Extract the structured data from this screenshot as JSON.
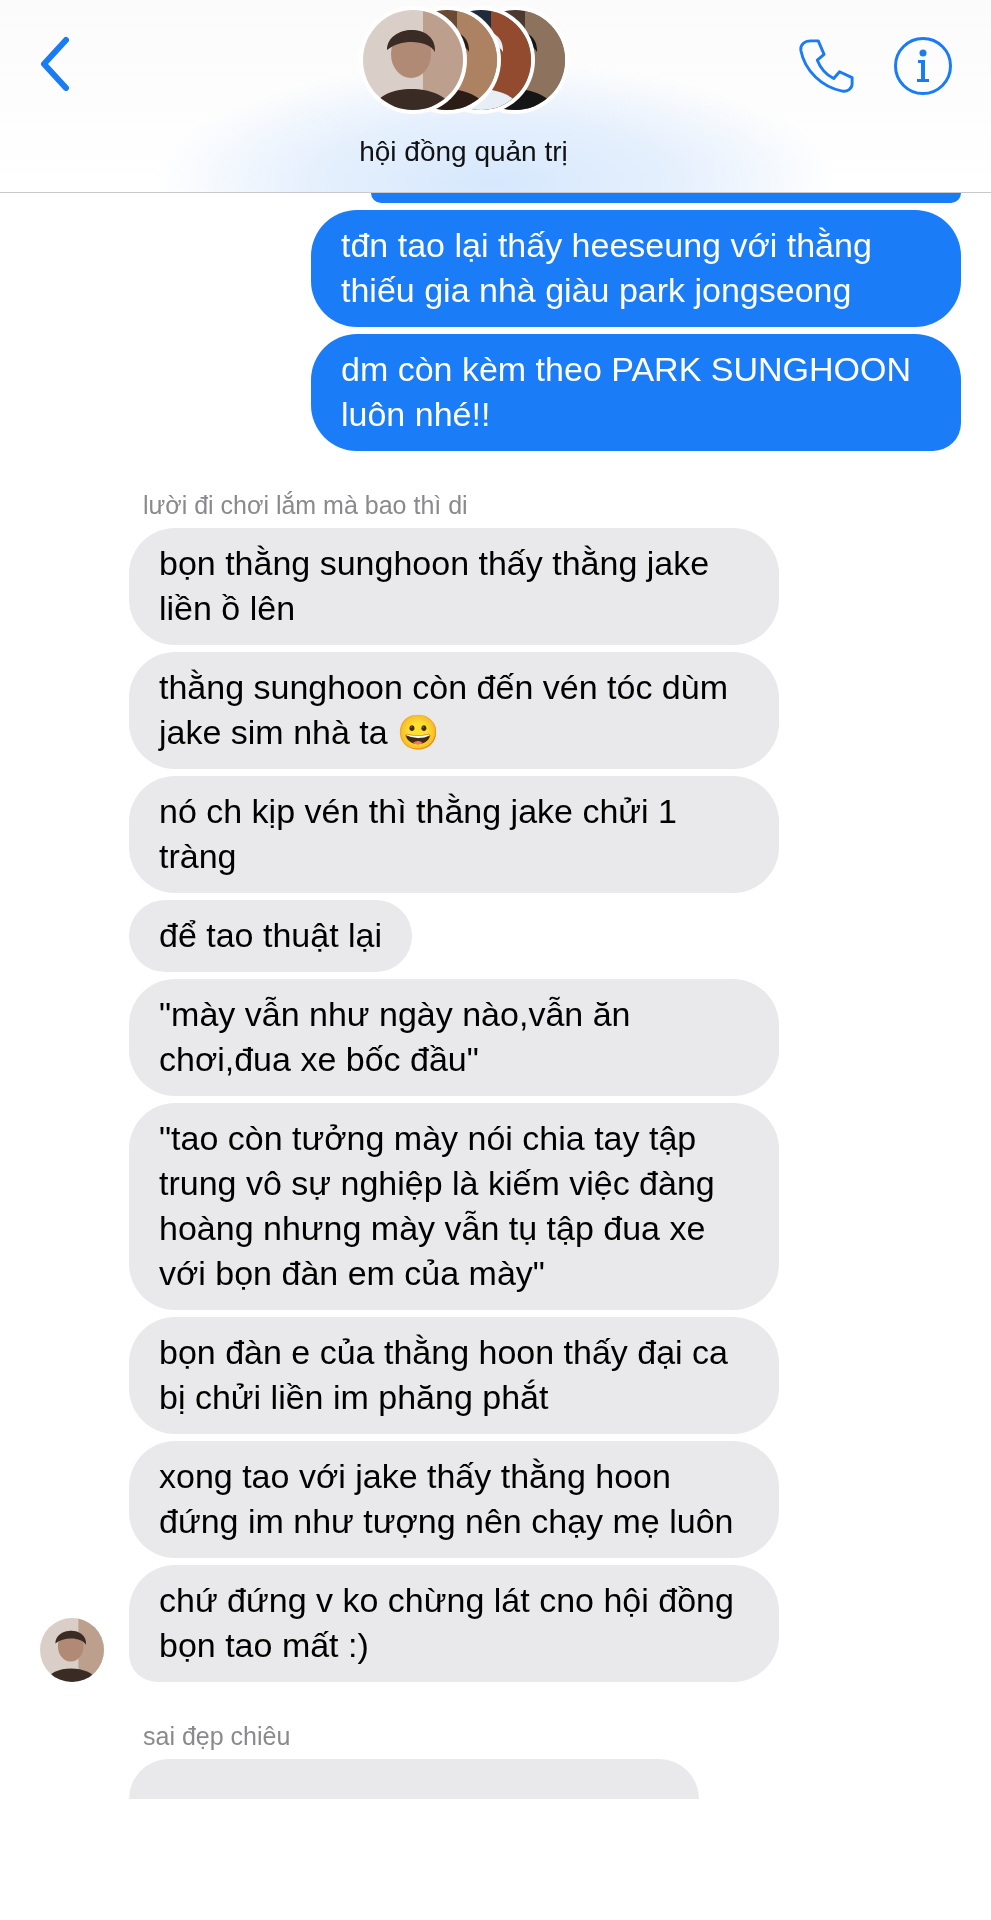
{
  "header": {
    "title": "hội đồng quản trị"
  },
  "messages": [
    {
      "kind": "sent_fragment"
    },
    {
      "kind": "sent",
      "text": "tđn tao lại thấy heeseung với thằng thiếu gia nhà giàu park jongseong",
      "tail": false
    },
    {
      "kind": "sent",
      "text": "dm còn kèm theo PARK SUNGHOON luôn nhé!!",
      "tail": true
    },
    {
      "kind": "sender",
      "text": "lười đi chơi lắm mà bao thì di"
    },
    {
      "kind": "received",
      "text": "bọn thằng sunghoon thấy thằng jake liền ồ lên",
      "tail": false
    },
    {
      "kind": "received",
      "text": "thằng sunghoon còn đến vén tóc dùm jake sim nhà ta 😀",
      "tail": false
    },
    {
      "kind": "received",
      "text": "nó ch kịp vén thì thằng jake chửi 1 tràng",
      "tail": false
    },
    {
      "kind": "received",
      "text": "để tao thuật lại",
      "tail": false
    },
    {
      "kind": "received",
      "text": "\"mày vẫn như ngày nào,vẫn ăn chơi,đua xe bốc đầu\"",
      "tail": false
    },
    {
      "kind": "received",
      "text": "\"tao còn tưởng mày nói chia tay tập trung vô sự nghiệp là kiếm việc đàng hoàng nhưng mày vẫn tụ tập đua xe với bọn đàn em của mày\"",
      "tail": false
    },
    {
      "kind": "received",
      "text": "bọn đàn e của thằng hoon thấy đại ca bị chửi liền im phăng phắt",
      "tail": false
    },
    {
      "kind": "received",
      "text": "xong tao với jake thấy thằng hoon đứng im như tượng nên chạy mẹ luôn",
      "tail": false
    },
    {
      "kind": "received",
      "text": "chứ đứng v ko chừng lát cno hội đồng bọn tao mất :)",
      "tail": true
    },
    {
      "kind": "sender",
      "text": "sai đẹp chiêu"
    },
    {
      "kind": "received_fragment"
    }
  ]
}
